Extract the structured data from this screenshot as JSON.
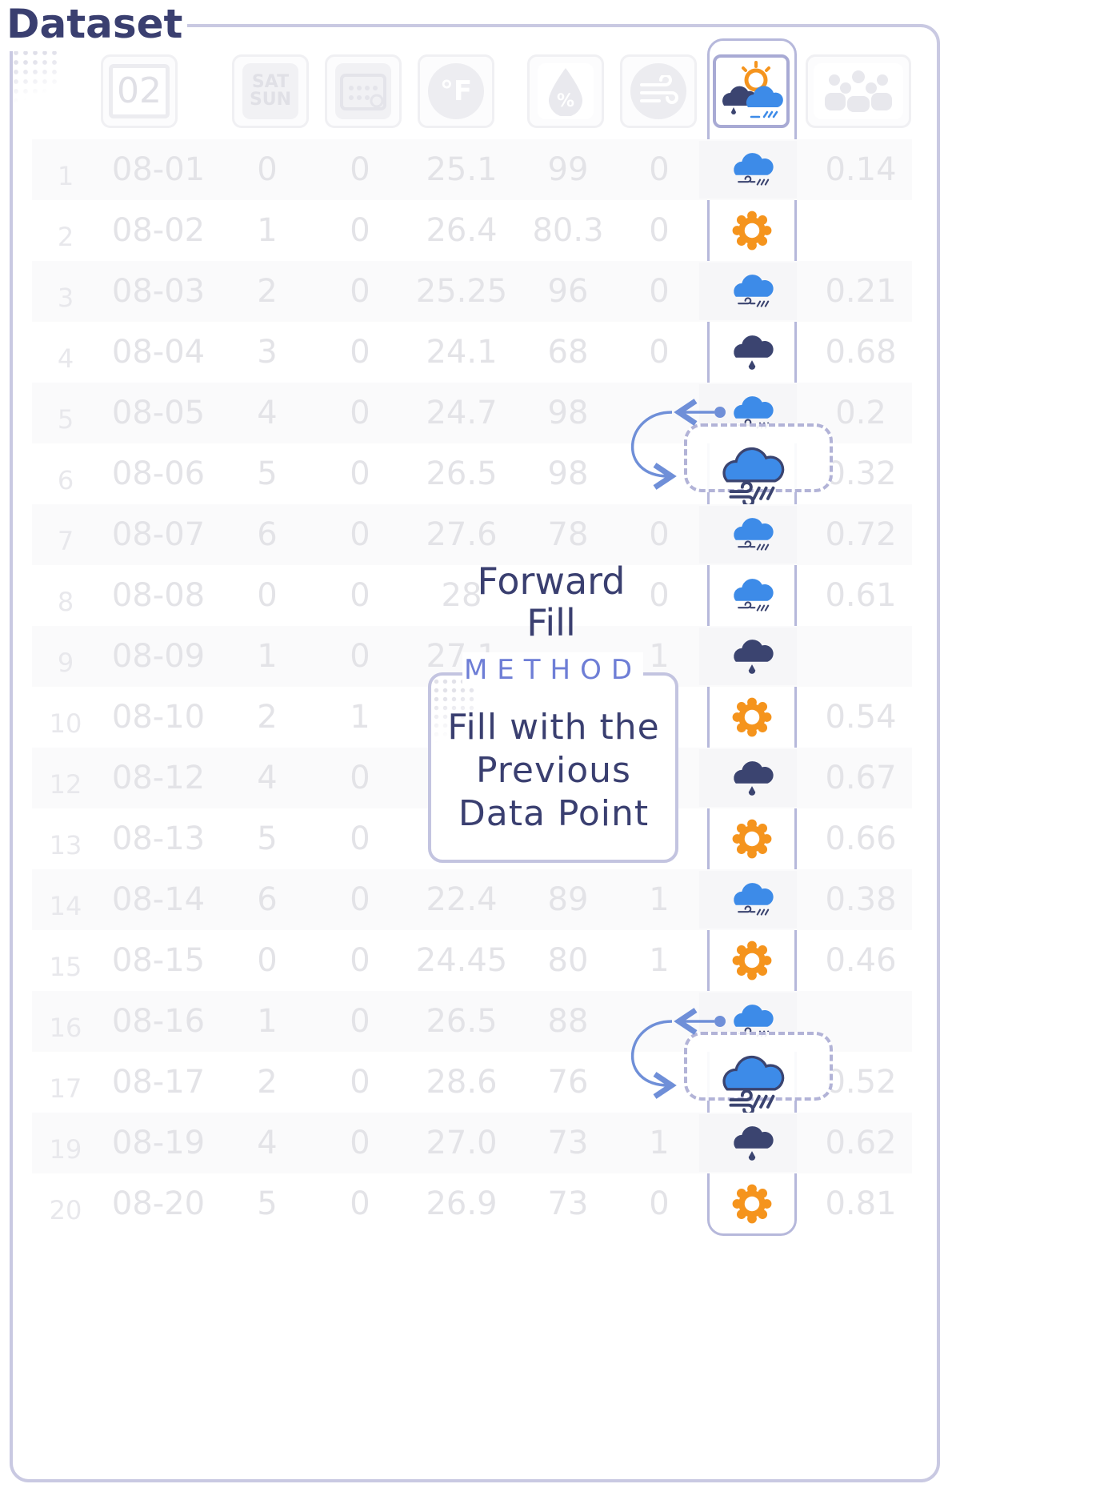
{
  "title": "Dataset",
  "header_icons": [
    "calendar-date-icon",
    "weekend-icon",
    "calendar-grid-icon",
    "temperature-icon",
    "humidity-icon",
    "wind-icon",
    "weather-condition-icon",
    "crowd-icon"
  ],
  "header_date_text": "02",
  "header_weekend_text": [
    "SAT",
    "SUN"
  ],
  "header_temp_text": "°F",
  "header_humidity_text": "%",
  "rows": [
    {
      "index": "1",
      "date": "08-01",
      "weekday": "0",
      "holiday": "0",
      "temp": "25.1",
      "humidity": "99",
      "wind": "0",
      "weather": "rain",
      "value": "0.14"
    },
    {
      "index": "2",
      "date": "08-02",
      "weekday": "1",
      "holiday": "0",
      "temp": "26.4",
      "humidity": "80.3",
      "wind": "0",
      "weather": "sun",
      "value": ""
    },
    {
      "index": "3",
      "date": "08-03",
      "weekday": "2",
      "holiday": "0",
      "temp": "25.25",
      "humidity": "96",
      "wind": "0",
      "weather": "rain",
      "value": "0.21"
    },
    {
      "index": "4",
      "date": "08-04",
      "weekday": "3",
      "holiday": "0",
      "temp": "24.1",
      "humidity": "68",
      "wind": "0",
      "weather": "drop",
      "value": "0.68"
    },
    {
      "index": "5",
      "date": "08-05",
      "weekday": "4",
      "holiday": "0",
      "temp": "24.7",
      "humidity": "98",
      "wind": "",
      "weather": "rain",
      "value": "0.2"
    },
    {
      "index": "6",
      "date": "08-06",
      "weekday": "5",
      "holiday": "0",
      "temp": "26.5",
      "humidity": "98",
      "wind": "",
      "weather": "rain-filled",
      "value": "0.32"
    },
    {
      "index": "7",
      "date": "08-07",
      "weekday": "6",
      "holiday": "0",
      "temp": "27.6",
      "humidity": "78",
      "wind": "0",
      "weather": "rain",
      "value": "0.72"
    },
    {
      "index": "8",
      "date": "08-08",
      "weekday": "0",
      "holiday": "0",
      "temp": "28",
      "humidity": "",
      "wind": "0",
      "weather": "rain",
      "value": "0.61"
    },
    {
      "index": "9",
      "date": "08-09",
      "weekday": "1",
      "holiday": "0",
      "temp": "27.1",
      "humidity": "",
      "wind": "1",
      "weather": "drop",
      "value": ""
    },
    {
      "index": "10",
      "date": "08-10",
      "weekday": "2",
      "holiday": "1",
      "temp": "",
      "humidity": "",
      "wind": "",
      "weather": "sun",
      "value": "0.54"
    },
    {
      "index": "12",
      "date": "08-12",
      "weekday": "4",
      "holiday": "0",
      "temp": "",
      "humidity": "",
      "wind": "",
      "weather": "drop",
      "value": "0.67"
    },
    {
      "index": "13",
      "date": "08-13",
      "weekday": "5",
      "holiday": "0",
      "temp": "",
      "humidity": "",
      "wind": "",
      "weather": "sun",
      "value": "0.66"
    },
    {
      "index": "14",
      "date": "08-14",
      "weekday": "6",
      "holiday": "0",
      "temp": "22.4",
      "humidity": "89",
      "wind": "1",
      "weather": "rain",
      "value": "0.38"
    },
    {
      "index": "15",
      "date": "08-15",
      "weekday": "0",
      "holiday": "0",
      "temp": "24.45",
      "humidity": "80",
      "wind": "1",
      "weather": "sun",
      "value": "0.46"
    },
    {
      "index": "16",
      "date": "08-16",
      "weekday": "1",
      "holiday": "0",
      "temp": "26.5",
      "humidity": "88",
      "wind": "",
      "weather": "rain",
      "value": ""
    },
    {
      "index": "17",
      "date": "08-17",
      "weekday": "2",
      "holiday": "0",
      "temp": "28.6",
      "humidity": "76",
      "wind": "",
      "weather": "rain-filled",
      "value": "0.52"
    },
    {
      "index": "19",
      "date": "08-19",
      "weekday": "4",
      "holiday": "0",
      "temp": "27.0",
      "humidity": "73",
      "wind": "1",
      "weather": "drop",
      "value": "0.62"
    },
    {
      "index": "20",
      "date": "08-20",
      "weekday": "5",
      "holiday": "0",
      "temp": "26.9",
      "humidity": "73",
      "wind": "0",
      "weather": "sun",
      "value": "0.81"
    }
  ],
  "forward_fill": {
    "title_line1": "Forward",
    "title_line2": "Fill",
    "method_label": "METHOD",
    "method_line1": "Fill with the",
    "method_line2": "Previous",
    "method_line3": "Data Point"
  },
  "colors": {
    "accent": "#3a3f70",
    "method_blue": "#6e7ed6",
    "cloud_blue": "#3d8be8",
    "cloud_dark": "#3b4470",
    "sun_orange": "#f5941d",
    "arrow_blue": "#6f8fd8",
    "border_lavender": "#c9c9e2"
  },
  "filled_rows": [
    "6",
    "17"
  ]
}
